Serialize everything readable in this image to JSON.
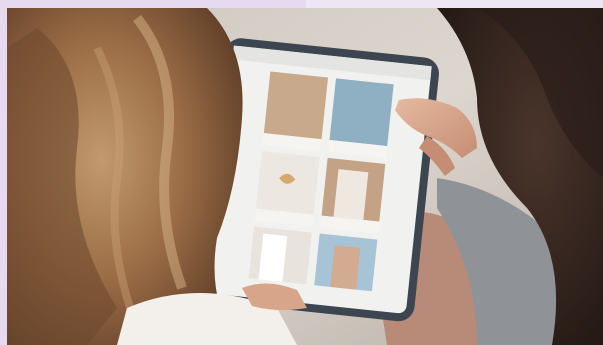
{
  "scene": {
    "description_icon": "photo-of-people-browsing-fashion-catalog-on-tablet",
    "colors": {
      "frame_bg": "#efe6f3",
      "frame_accent": "#e6daf0",
      "wall": "#d9d2cb",
      "hair_left": "#9b6d46",
      "hair_right": "#3a2a22",
      "skin": "#d9a98f",
      "tablet_case": "#3c4550",
      "tablet_screen": "#f1f1ef",
      "tile_beige": "#c9a98b",
      "tile_blue": "#8fb0c2",
      "tile_cream": "#ece7e1",
      "tile_sky": "#a7c4d6"
    }
  }
}
